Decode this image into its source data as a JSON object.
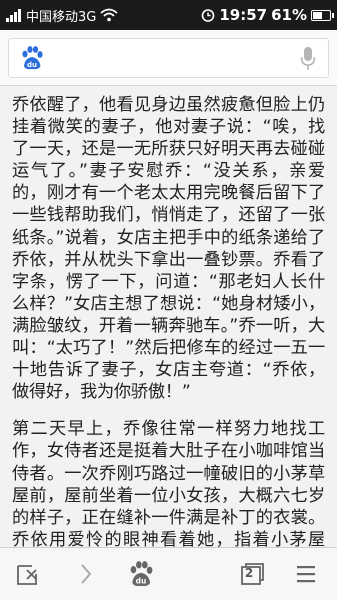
{
  "status_bar": {
    "carrier": "中国移动3G",
    "time": "19:57",
    "battery_percent": "61%",
    "battery_level": 0.61
  },
  "search_bar": {
    "logo_icon": "baidu-paw-icon",
    "mic_icon": "microphone-icon"
  },
  "article": {
    "paragraphs": [
      "乔依醒了，他看见身边虽然疲惫但脸上仍挂着微笑的妻子，他对妻子说：“唉，找了一天，还是一无所获只好明天再去碰碰运气了。”妻子安慰乔：“没关系，亲爱的，刚才有一个老太太用完晚餐后留下了一些钱帮助我们，悄悄走了，还留了一张纸条。”说着，女店主把手中的纸条递给了乔依，并从枕头下拿出一叠钞票。乔看了字条，愣了一下，问道：“那老妇人长什么样？”女店主想了想说：“她身材矮小，满脸皱纹，开着一辆奔驰车。”乔一听，大叫：“太巧了！”然后把修车的经过一五一十地告诉了妻子，女店主夸道：“乔依，做得好，我为你骄傲！”",
      "第二天早上，乔像往常一样努力地找工作，女侍者还是挺着大肚子在小咖啡馆当侍者。一次乔刚巧路过一幢破旧的小茅草屋前，屋前坐着一位小女孩，大概六七岁的样子，正在缝补一件满是补丁的衣裳。乔依用爱怜的眼神看着她，指着小茅屋问：“这是你的家吗？”是呀”小女孩答道。“你的家人呢？”没有了，唯一爱我的"
    ]
  },
  "toolbar": {
    "tab_count": "2",
    "icons": [
      "close-page-icon",
      "forward-icon",
      "baidu-home-icon",
      "tabs-icon",
      "menu-icon"
    ]
  }
}
